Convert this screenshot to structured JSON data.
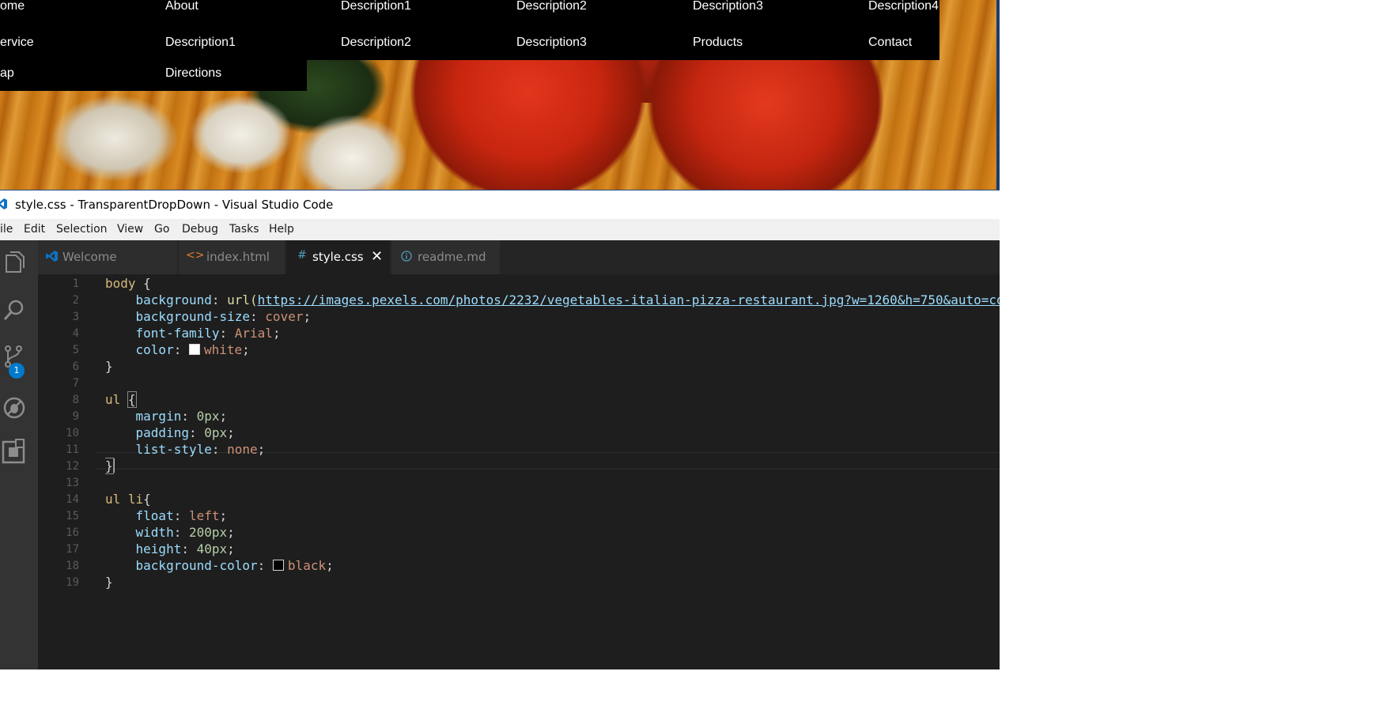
{
  "preview": {
    "nav_row1": [
      "ome",
      "About",
      "Description1",
      "Description2",
      "Description3",
      "Description4"
    ],
    "nav_row2": [
      "ervice",
      "Description1",
      "Description2",
      "Description3",
      "Products",
      "Contact"
    ],
    "nav_row3": [
      "ap",
      "Directions"
    ]
  },
  "window": {
    "title": "style.css - TransparentDropDown - Visual Studio Code"
  },
  "menu": [
    "ile",
    "Edit",
    "Selection",
    "View",
    "Go",
    "Debug",
    "Tasks",
    "Help"
  ],
  "tabs": [
    {
      "label": "Welcome",
      "icon": "vscode-icon",
      "active": false
    },
    {
      "label": "index.html",
      "icon": "html-icon",
      "active": false
    },
    {
      "label": "style.css",
      "icon": "css-hash-icon",
      "active": true
    },
    {
      "label": "readme.md",
      "icon": "info-icon",
      "active": false
    }
  ],
  "activity": {
    "icons": [
      "explorer-icon",
      "search-icon",
      "source-control-icon",
      "debug-icon",
      "extensions-icon"
    ],
    "source_control_badge": "1"
  },
  "editor": {
    "line_numbers": [
      "1",
      "2",
      "3",
      "4",
      "5",
      "6",
      "7",
      "8",
      "9",
      "10",
      "11",
      "12",
      "13",
      "14",
      "15",
      "16",
      "17",
      "18",
      "19"
    ],
    "l1_sel": "body",
    "l1_brace": " {",
    "l2_prop": "background",
    "l2_fn": "url(",
    "l2_url": "https://images.pexels.com/photos/2232/vegetables-italian-pizza-restaurant.jpg?w=1260&h=750&auto=co",
    "l3_prop": "background-size",
    "l3_val": "cover",
    "l4_prop": "font-family",
    "l4_val": "Arial",
    "l5_prop": "color",
    "l5_val": "white",
    "l6": "}",
    "l8_sel": "ul",
    "l8_brace": "{",
    "l9_prop": "margin",
    "l9_val": "0px",
    "l10_prop": "padding",
    "l10_val": "0px",
    "l11_prop": "list-style",
    "l11_val": "none",
    "l12": "}",
    "l14_sel": "ul li",
    "l14_brace": "{",
    "l15_prop": "float",
    "l15_val": "left",
    "l16_prop": "width",
    "l16_val": "200px",
    "l17_prop": "height",
    "l17_val": "40px",
    "l18_prop": "background-color",
    "l18_val": "black",
    "l19": "}",
    "swatch_white": "#ffffff",
    "swatch_black": "#000000"
  },
  "colors": {
    "editor_bg": "#1e1e1e",
    "activity_bg": "#333333",
    "tab_bg": "#2d2d2d",
    "badge": "#007acc"
  }
}
